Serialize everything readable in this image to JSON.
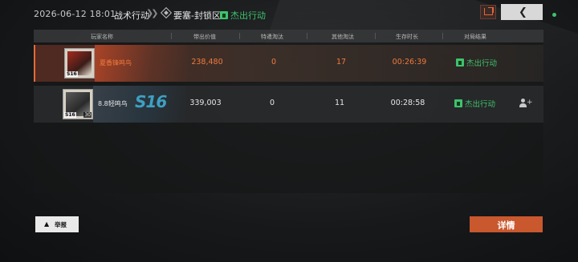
{
  "header": {
    "timestamp": "2026-06-12 18:01",
    "mode": "战术行动",
    "separator_icon": "double-chevron-right-icon",
    "map_icon": "diamond-map-icon",
    "map": "要塞-封锁区",
    "result": "杰出行动",
    "share_icon": "share-icon",
    "back_icon": "chevron-left-icon"
  },
  "table": {
    "columns": [
      "玩家名称",
      "带出价值",
      "特遣淘汰",
      "其他淘汰",
      "生存时长",
      "对局结果"
    ],
    "rows": [
      {
        "season": "S16",
        "level": "",
        "name": "夏香锋鸣鸟",
        "value": "238,480",
        "special_kills": "0",
        "other_kills": "17",
        "survival": "00:26:39",
        "result": "杰出行动",
        "highlight": true
      },
      {
        "season": "S16",
        "level": "30",
        "banner_text": "S16",
        "name": "8.8轻鸣鸟",
        "value": "339,003",
        "special_kills": "0",
        "other_kills": "11",
        "survival": "00:28:58",
        "result": "杰出行动",
        "action_icon": "add-friend-icon",
        "highlight": false
      }
    ]
  },
  "footer": {
    "report_label": "举报",
    "report_icon": "warning-icon",
    "detail_label": "详情"
  },
  "colors": {
    "accent_orange": "#e56a3a",
    "success_green": "#3fc26b",
    "detail_button": "#c9582e"
  }
}
